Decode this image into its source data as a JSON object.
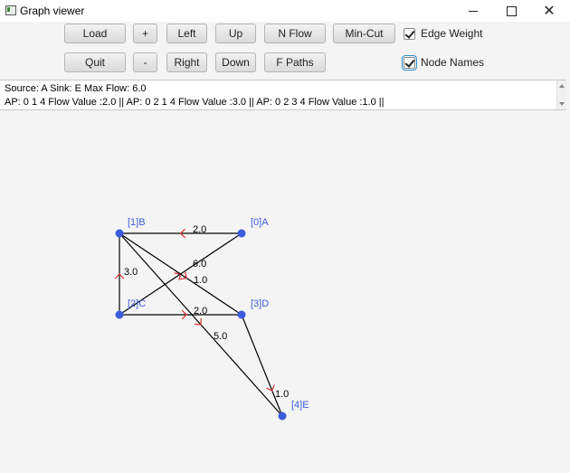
{
  "window": {
    "title": "Graph viewer"
  },
  "toolbar": {
    "load": "Load",
    "plus": "+",
    "left": "Left",
    "up": "Up",
    "nflow": "N Flow",
    "mincut": "Min-Cut",
    "quit": "Quit",
    "minus": "-",
    "right": "Right",
    "down": "Down",
    "fpaths": "F Paths"
  },
  "options": {
    "edge_weight": {
      "label": "Edge Weight",
      "checked": true
    },
    "node_names": {
      "label": "Node Names",
      "checked": true
    }
  },
  "info": {
    "line1": "Source: A Sink: E Max Flow: 6.0",
    "line2": "AP: 0 1 4 Flow Value :2.0 || AP: 0 2 1 4 Flow Value :3.0 || AP: 0 2 3 4 Flow Value :1.0 ||"
  },
  "graph": {
    "colors": {
      "node": "#3b5bdb",
      "node_label": "#3b5bdb",
      "edge": "#000000",
      "arrow": "#e03030",
      "weight": "#000000"
    },
    "nodes": [
      {
        "id": "A",
        "label": "[0]A"
      },
      {
        "id": "B",
        "label": "[1]B"
      },
      {
        "id": "C",
        "label": "[2]C"
      },
      {
        "id": "D",
        "label": "[3]D"
      },
      {
        "id": "E",
        "label": "[4]E"
      }
    ],
    "edges": [
      {
        "from": "A",
        "to": "B",
        "weight": "2.0"
      },
      {
        "from": "C",
        "to": "B",
        "weight": "3.0"
      },
      {
        "from": "C",
        "to": "A",
        "weight": "6.0"
      },
      {
        "from": "B",
        "to": "D",
        "weight": "1.0"
      },
      {
        "from": "C",
        "to": "D",
        "weight": "2.0"
      },
      {
        "from": "B",
        "to": "E",
        "weight": "5.0"
      },
      {
        "from": "D",
        "to": "E",
        "weight": "1.0"
      }
    ]
  }
}
